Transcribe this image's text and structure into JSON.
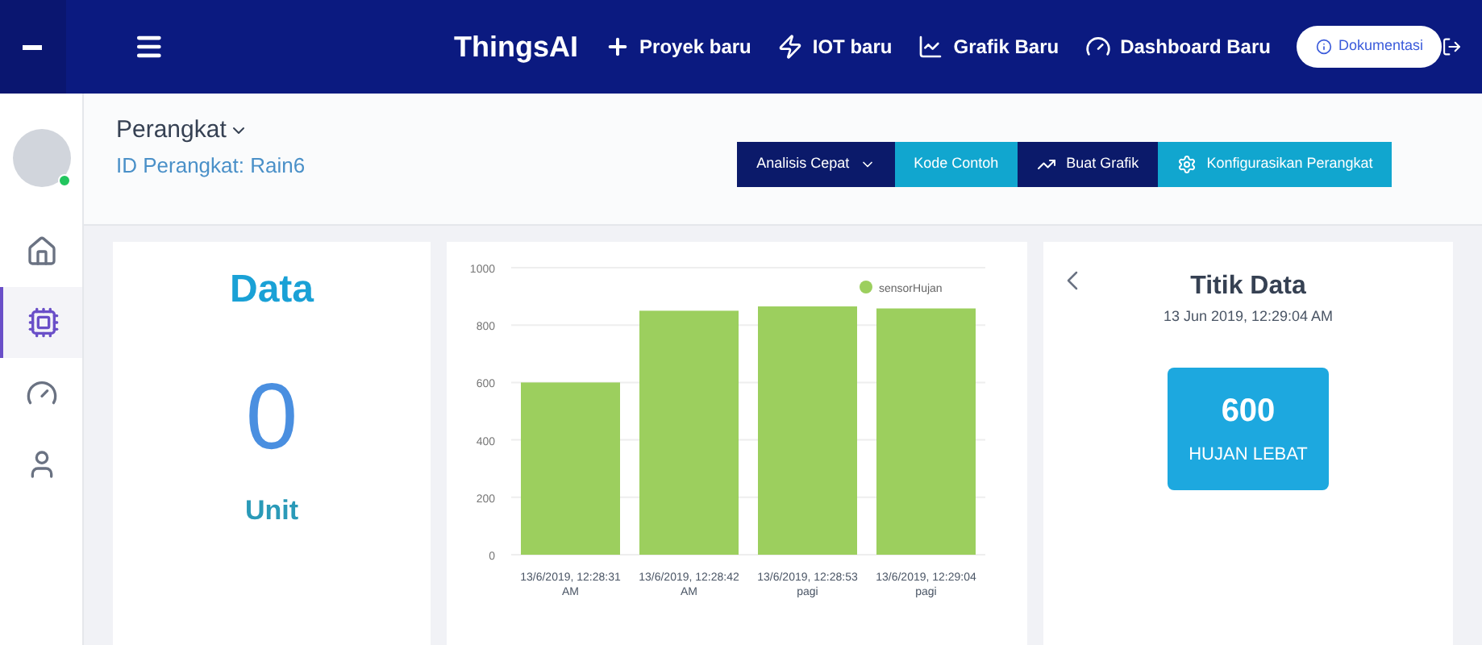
{
  "topbar": {
    "brand": "ThingsAI",
    "nav": [
      {
        "kind": "plus",
        "label": "Proyek baru"
      },
      {
        "kind": "bolt",
        "label": "IOT baru"
      },
      {
        "kind": "chart",
        "label": "Grafik Baru"
      },
      {
        "kind": "gauge",
        "label": "Dashboard Baru"
      }
    ],
    "docs_button": "Dokumentasi"
  },
  "sidebar": {
    "user_online": true,
    "items": [
      {
        "kind": "home",
        "selected": false
      },
      {
        "kind": "chip",
        "selected": true
      },
      {
        "kind": "gauge",
        "selected": false
      },
      {
        "kind": "user",
        "selected": false
      }
    ]
  },
  "header": {
    "title": "Perangkat",
    "device_id": "ID Perangkat: Rain6",
    "actions": [
      {
        "kind": "dropdown",
        "label": "Analisis Cepat"
      },
      {
        "kind": "plain",
        "label": "Kode Contoh"
      },
      {
        "kind": "chart",
        "label": "Buat Grafik"
      },
      {
        "kind": "gear",
        "label": "Konfigurasikan Perangkat"
      }
    ]
  },
  "data_card": {
    "title": "Data",
    "value": "0",
    "unit": "Unit"
  },
  "chart": {
    "chart_data": {
      "type": "bar",
      "categories": [
        "13/6/2019, 12:28:31 AM",
        "13/6/2019, 12:28:42 AM",
        "13/6/2019, 12:28:53 pagi",
        "13/6/2019, 12:29:04 pagi"
      ],
      "series": [
        {
          "name": "sensorHujan",
          "color": "#9ccf5e",
          "values": [
            600,
            850,
            865,
            858
          ]
        }
      ],
      "ylim": [
        0,
        1000
      ],
      "yticks": [
        0,
        200,
        400,
        600,
        800,
        1000
      ],
      "grid": true
    }
  },
  "datapoint_card": {
    "title": "Titik Data",
    "timestamp": "13 Jun 2019, 12:29:04 AM",
    "value": "600",
    "status": "HUJAN LEBAT"
  }
}
